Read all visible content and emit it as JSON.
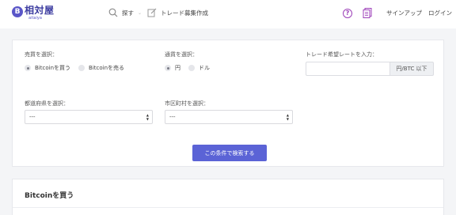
{
  "header": {
    "logo_badge": "B",
    "logo_main": "相対屋",
    "logo_sub": "aitaiya",
    "nav_search_label": "探す",
    "nav_create_label": "トレード募集作成",
    "signup_label": "サインアップ",
    "login_label": "ログイン"
  },
  "form": {
    "trade_type_label": "売買を選択：",
    "trade_type_options": [
      "Bitcoinを買う",
      "Bitcoinを売る"
    ],
    "trade_type_selected": "Bitcoinを買う",
    "currency_label": "通貨を選択：",
    "currency_options": [
      "円",
      "ドル"
    ],
    "currency_selected": "円",
    "rate_label": "トレード希望レートを入力：",
    "rate_value": "",
    "rate_unit": "円/BTC 以下",
    "prefecture_label": "都道府県を選択：",
    "prefecture_value": "---",
    "city_label": "市区町村を選択：",
    "city_value": "---",
    "search_button_label": "この条件で検索する"
  },
  "results": {
    "title": "Bitcoinを買う"
  },
  "colors": {
    "brand": "#3c3ca0",
    "accent": "#5b63d6",
    "help_icon": "#9c3fb8"
  },
  "icons": [
    "magnifier-icon",
    "chevron-down-icon",
    "edit-icon",
    "help-icon",
    "document-icon"
  ]
}
